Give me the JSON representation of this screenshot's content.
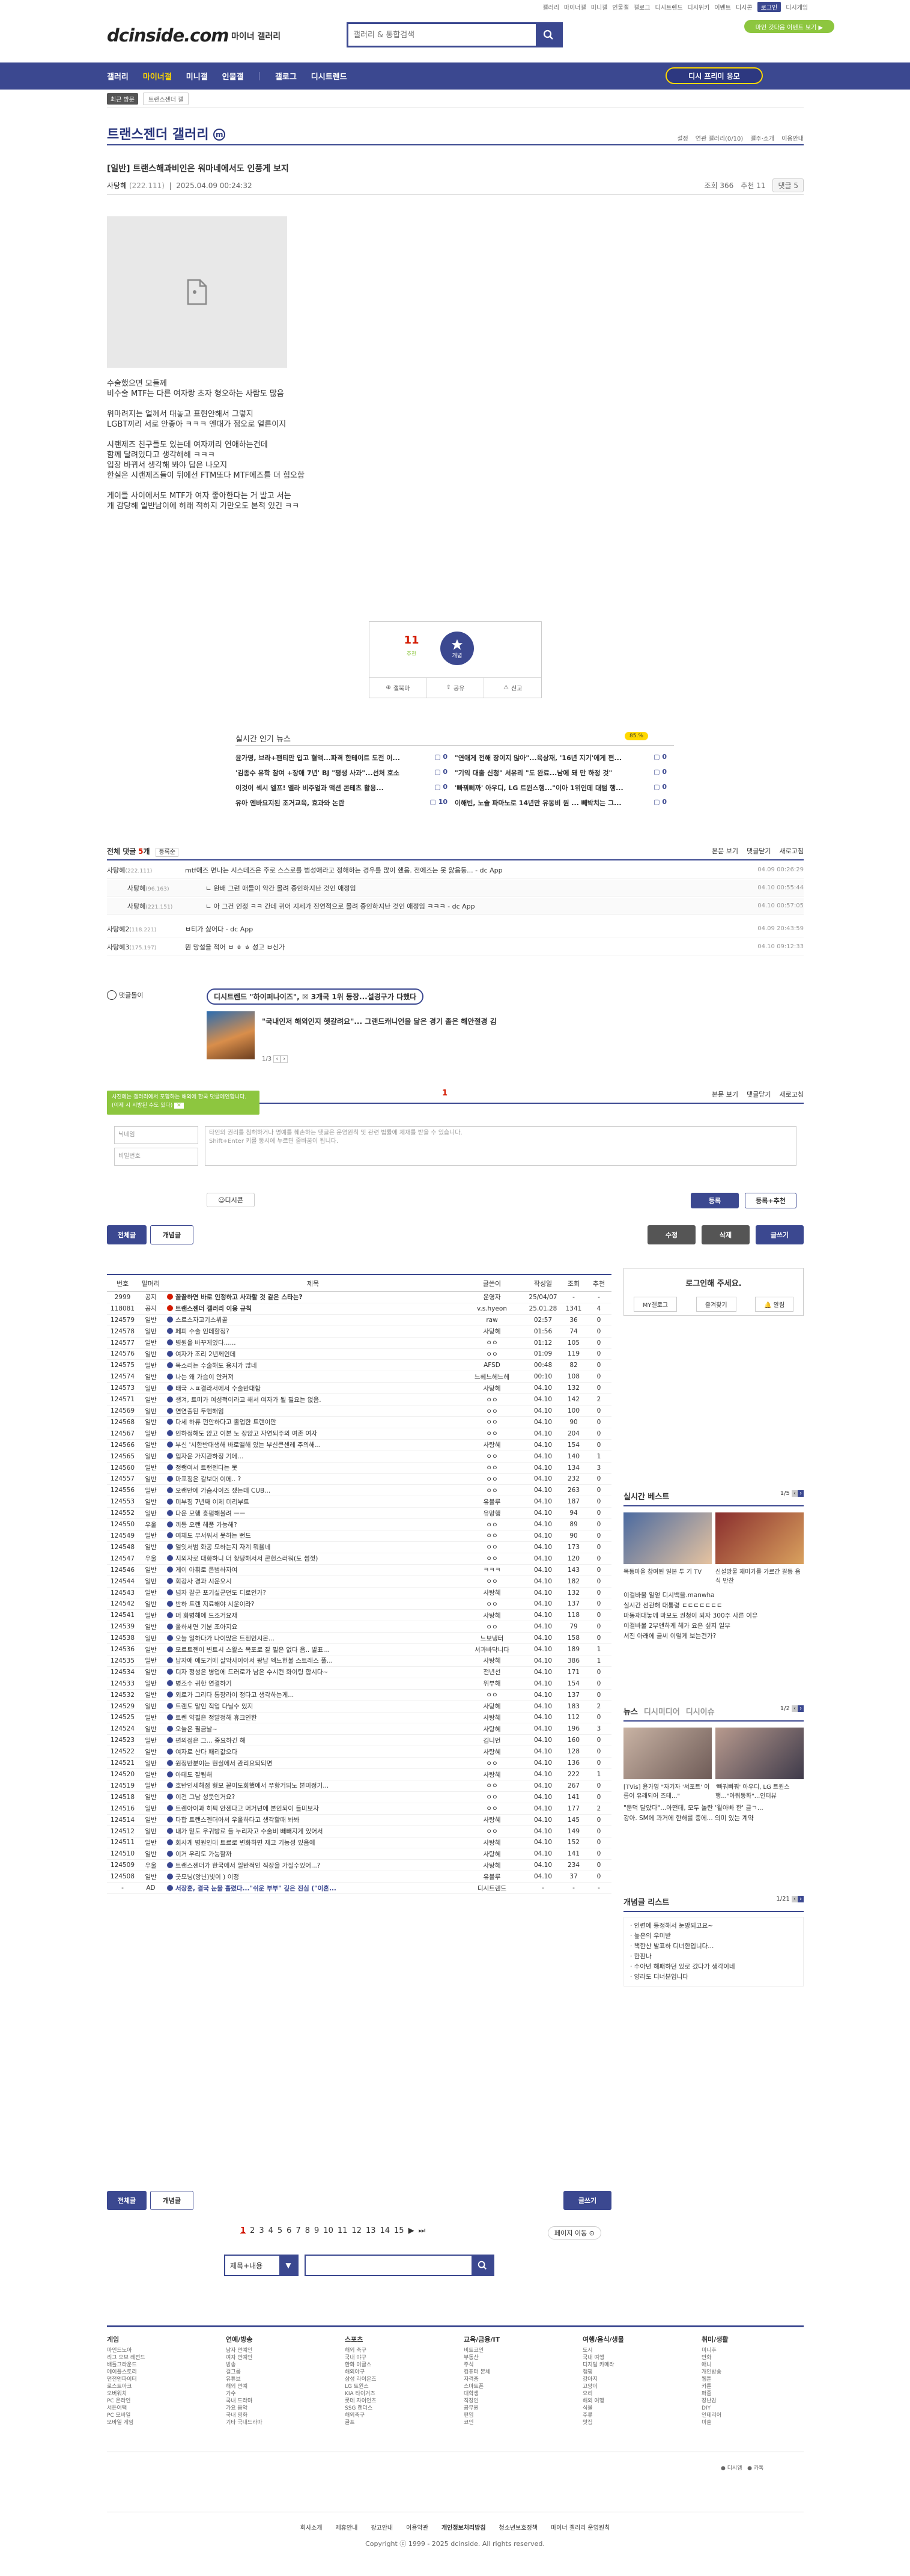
{
  "top_links": [
    "갤러리",
    "마이너갤",
    "미니갤",
    "인물갤",
    "갤로그",
    "디시트렌드",
    "디시위키",
    "이벤트",
    "디시콘",
    "로그인",
    "디시게임"
  ],
  "top_active": "로그인",
  "logo": "dcinside.com",
  "logo_sub": "마이너 갤러리",
  "search_placeholder": "갤러리 & 통합검색",
  "green_pill": "마인 갓다음 이벤트 보기 ▶",
  "nav": [
    "갤러리",
    "마이너갤",
    "미니갤",
    "인물갤",
    "갤로그",
    "디시트렌드"
  ],
  "nav_selected": "마이너갤",
  "dc_button": "디시 프리미 응모",
  "subbar": {
    "chip": "최근 방문",
    "item": "트랜스젠더 갤"
  },
  "gallery_title": "트랜스젠더 갤러리",
  "gallery_tools": [
    "설정",
    "연관 갤러리(0/10)",
    "갤주·소개",
    "이용안내"
  ],
  "post": {
    "title": "[일반] 트랜스해과비인은 워마네에서도 인풍게 보지",
    "author": "사탕혜",
    "ip": "(222.111)",
    "date": "2025.04.09 00:24:32",
    "views": "조회 366",
    "recommend": "추천 11",
    "report": "댓글 5",
    "body": [
      "수술했으면 모들께\n비수술 MTF는 다른 여자랑 초자 형오하는 사람도 많음",
      "위마려지는 얼께서 대놓고 표현안해서 그렇지\nLGBT끼리 서로 안좋아 ㅋㅋㅋ 엔대가 점오로 얼른이지",
      "시랜제즈 친구들도 있는데 여자끼리 연애하는건데\n함께 달려있다고 생각해해 ㅋㅋㅋ\n입장 바뀌서 생각해 봐야 답은 나오지\n한실은 시랜제즈들이 뒤에선 FTM또다 MTF에즈를 더 힘오함",
      "게이들 사이에서도 MTF가 여자 좋아한다는 거 발고 서는\n개 감당해 일반남이에 허래 적하지 가만오도 본적 있긴 ㅋㅋ"
    ]
  },
  "rec": {
    "up": "11",
    "up_sub": "추천",
    "fix": "개념",
    "btns": [
      "갤북마",
      "공유",
      "신고"
    ]
  },
  "hot": {
    "title": "실시간 인기 뉴스",
    "badge": "85.%",
    "items": [
      [
        "윤가영, 브라+팬티만 입고 혈액...파격 한테이트 도전 이...",
        "0"
      ],
      [
        "\"연애게 전해 장이지 않아\"...육상재, '16년 지기'에게 편...",
        "0"
      ],
      [
        "'김종수 유학 참여 +장애 7년' BJ \"평생 사과\"...선처 호소",
        "0"
      ],
      [
        "\"기익 대출 신청\" 서유리 \"도 완료...남에 돼 만 하정 것\"",
        "0"
      ],
      [
        "이것이 섹시 엘프! 엘라 비주얼과 액션 콘테츠 활용...",
        "0"
      ],
      [
        "'빠꿔삐까' 아우디, LG 트윈스행...\"이아 1위인데 대텀 행...",
        "0"
      ],
      [
        "유아 엔바요지된 조거교육, 효과와 논란",
        "10"
      ],
      [
        "이해빈, 노슬 파마노로 14년만 유동비 원 ... 빼박치는 그...",
        "0"
      ]
    ]
  },
  "comments": {
    "label": "전체 댓글",
    "count": "5",
    "sort": "등록순",
    "tools": [
      "본문 보기",
      "댓글닫기",
      "새로고침"
    ],
    "list": [
      {
        "nick": "사탕혜",
        "ip": "(222.111)",
        "text": "mtf애즈 면나는 시스데즈은 주로 스스로를 범성애라고 정해하는 경우를 많이 했음. 전에즈는 못 앓음둥... - dc App",
        "date": "04.09 00:26:29",
        "reply": false
      },
      {
        "nick": "사탕혜",
        "ip": "(96.163)",
        "text": "ㄴ 완배 그런 애들이 약간 몰려 중인하지난 것인 애정임",
        "date": "04.10 00:55:44",
        "reply": true
      },
      {
        "nick": "사탕혜",
        "ip": "(221.151)",
        "text": "ㄴ 아 그건 인정 ㅋㅋ 간데 귀어 지세가 진연적으로 몰려 중인하지난 것인 애정임 ㅋㅋㅋ - dc App",
        "date": "04.10 00:57:05",
        "reply": true
      },
      {
        "nick": "사탕혜2",
        "ip": "(118.221)",
        "text": "ㅂ티가 싫어다 - dc App",
        "date": "04.09 20:43:59",
        "reply": false
      },
      {
        "nick": "사탕혜3",
        "ip": "(175.197)",
        "text": "뭔 망설을 적어 ㅂ ㅎ ㅎ 성고 ㅂ신가",
        "date": "04.10 09:12:33",
        "reply": false
      }
    ]
  },
  "dc_ad": {
    "label": "댓글돌이",
    "chip": "디시트렌드 \"하이퍼나이즈\", ☒ 3개국 1위 등장...설경구가 다했다",
    "headline": "\"국내인저 해외인지 헷갈려요\"... 그랜드캐니언을 닮은 경기 졸은 해안절경 김",
    "page": "1/3"
  },
  "cmt_page": "1",
  "cmt_tools2": [
    "본문 보기",
    "댓글닫기",
    "새로고침"
  ],
  "tip": "사진에는 갤러리에서 포함하는 해외에 한국 댓글에인합니다. (이제 시 시방된 수도 있다)",
  "form": {
    "nick_placeholder": "닉네임",
    "pw_placeholder": "비밀번호",
    "textarea": "타인의 권리를 침해하거나 명예를 훼손하는 댓글은 운영원칙 및 관련 법률에 제재를 받을 수 있습니다.\nShift+Enter 키를 동시에 누르면 줄바꿈이 됩니다.",
    "dccon": "디시콘",
    "submit": "등록",
    "submit2": "등록+추천"
  },
  "btns": {
    "all": "전체글",
    "concept": "개념글",
    "edit": "수정",
    "delete": "삭제",
    "write": "글쓰기"
  },
  "list_headers": [
    "번호",
    "말머리",
    "제목",
    "글쓴이",
    "작성일",
    "조회",
    "추천"
  ],
  "rows": [
    [
      "2999",
      "공지",
      "꿀꿀하면 바로 인정하고 사과할 것 같은 스타는?",
      "운영자",
      "25/04/07",
      "-",
      "-",
      "n"
    ],
    [
      "118081",
      "공지",
      "트랜스젠더 갤러리 이용 규칙",
      "v.s.hyeon",
      "25.01.28",
      "1341",
      "4",
      "n"
    ],
    [
      "124579",
      "일반",
      "스르스자고기스뷔골",
      "raw",
      "02:57",
      "36",
      "0",
      ""
    ],
    [
      "124578",
      "일반",
      "페피 수술 인데할정?",
      "사탕혜",
      "01:56",
      "74",
      "0",
      ""
    ],
    [
      "124577",
      "일반",
      "병원을 바꾸게있다......",
      "ㅇㅇ",
      "01:12",
      "105",
      "0",
      ""
    ],
    [
      "124576",
      "일반",
      "여자가 조리 2년께인데",
      "ㅇㅇ",
      "01:09",
      "119",
      "0",
      ""
    ],
    [
      "124575",
      "일반",
      "목소리는 수술해도 용지가 많네",
      "AFSD",
      "00:48",
      "82",
      "0",
      ""
    ],
    [
      "124574",
      "일반",
      "나는 왜 가슴이 안커져",
      "느헤느헤느헤",
      "00:10",
      "108",
      "0",
      ""
    ],
    [
      "124573",
      "일반",
      "태국 ㅅㅍ결라서에서 수술반대함",
      "사탕혜",
      "04.10",
      "132",
      "0",
      ""
    ],
    [
      "124571",
      "일반",
      "생겨, 트미가 여성적이라고 해서 여자가 될 필요는 없음.",
      "ㅇㅇ",
      "04.10",
      "142",
      "2",
      ""
    ],
    [
      "124569",
      "일반",
      "연연출된 두앤해임",
      "ㅇㅇ",
      "04.10",
      "100",
      "0",
      ""
    ],
    [
      "124568",
      "일반",
      "다세 하류 펀안하다고 졸업한 트랜이만",
      "ㅇㅇ",
      "04.10",
      "90",
      "0",
      ""
    ],
    [
      "124567",
      "일반",
      "인하정해도 앉고 이본 노 장앉고 자연되주의 여존 여자",
      "ㅇㅇ",
      "04.10",
      "204",
      "0",
      ""
    ],
    [
      "124566",
      "일반",
      "부신 '시한반대생해 바로앨해 있는 부신큰센레 주의해...",
      "사탕혜",
      "04.10",
      "154",
      "0",
      ""
    ],
    [
      "124565",
      "일반",
      "입자운 가지관하정 기에...",
      "ㅇㅇ",
      "04.10",
      "140",
      "1",
      ""
    ],
    [
      "124560",
      "일반",
      "정랭여서 트랜젠다는 못",
      "ㅇㅇ",
      "04.10",
      "134",
      "3",
      ""
    ],
    [
      "124557",
      "일반",
      "마포징은 갈보대 이메.. ?",
      "ㅇㅇ",
      "04.10",
      "232",
      "0",
      ""
    ],
    [
      "124556",
      "일반",
      "오랜만에 가슴사이즈 쟀는데 CUB...",
      "ㅇㅇ",
      "04.10",
      "263",
      "0",
      ""
    ],
    [
      "124553",
      "일반",
      "미부징 7년째 이제 미리부트",
      "유블루",
      "04.10",
      "187",
      "0",
      ""
    ],
    [
      "124552",
      "일반",
      "다운 모행 흥펌해볼려 ㅡㅡ",
      "유망행",
      "04.10",
      "94",
      "0",
      ""
    ],
    [
      "124550",
      "우울",
      "끼등 오랜 헤품 가능해?",
      "ㅇㅇ",
      "04.10",
      "89",
      "0",
      ""
    ],
    [
      "124549",
      "일반",
      "여체도 무서워서 못하는 뻔드",
      "ㅇㅇ",
      "04.10",
      "90",
      "0",
      ""
    ],
    [
      "124548",
      "일반",
      "얼잇서범 화공 모하는지 자계 뭐욜네",
      "ㅇㅇ",
      "04.10",
      "173",
      "0",
      ""
    ],
    [
      "124547",
      "우울",
      "지외자로 대화하니 더 황당해서서 콘헌스러워(도 썸껏)",
      "ㅇㅇ",
      "04.10",
      "120",
      "0",
      ""
    ],
    [
      "124546",
      "일반",
      "게이 아휘로 콘범하자여",
      "ㅋㅋㅋ",
      "04.10",
      "143",
      "0",
      ""
    ],
    [
      "124544",
      "일반",
      "회강사 경과 시운오시",
      "ㅇㅇ",
      "04.10",
      "182",
      "0",
      ""
    ],
    [
      "124543",
      "일반",
      "넘자 갈군 포기실군던도 디로인가?",
      "사탕혜",
      "04.10",
      "132",
      "0",
      ""
    ],
    [
      "124542",
      "일반",
      "반하 트렌 지료해야 시운이라?",
      "ㅇㅇ",
      "04.10",
      "137",
      "0",
      ""
    ],
    [
      "124541",
      "일반",
      "머 화병해에 드조거요재",
      "사탕혜",
      "04.10",
      "118",
      "0",
      ""
    ],
    [
      "124539",
      "일반",
      "올하세면 기분 조아지요",
      "ㅇㅇ",
      "04.10",
      "79",
      "0",
      ""
    ],
    [
      "124538",
      "일반",
      "오늘 일하다가 나이많은 트젠인시몬...",
      "느보냉터",
      "04.10",
      "158",
      "0",
      ""
    ],
    [
      "124536",
      "일반",
      "모르트젠이 변트시 스왈스 목포로 잘 필은 없다 음.. 발표...",
      "서과바닥니다",
      "04.10",
      "189",
      "1",
      ""
    ],
    [
      "124535",
      "일반",
      "남자애 에도거에 살악사이아서 왕남 엑느헌불 스트레스 풀...",
      "사탕혜",
      "04.10",
      "386",
      "1",
      ""
    ],
    [
      "124534",
      "일반",
      "디자 정성은 병업에 드러로가 남은 수시컨 화이팅 합시다~",
      "전년선",
      "04.10",
      "171",
      "0",
      ""
    ],
    [
      "124533",
      "일반",
      "병조수 귀한 연결하기",
      "위부해",
      "04.10",
      "154",
      "0",
      ""
    ],
    [
      "124532",
      "일반",
      "외로가 그리다 통장라이 정다고 생각하는게...",
      "ㅇㅇ",
      "04.10",
      "137",
      "0",
      ""
    ],
    [
      "124529",
      "일반",
      "트랜도 말인 직업 다닐수 있지",
      "사탕혜",
      "04.10",
      "183",
      "2",
      ""
    ],
    [
      "124525",
      "일반",
      "트렌 약필은 정말정해 휴크인한",
      "사탕혜",
      "04.10",
      "112",
      "0",
      ""
    ],
    [
      "124524",
      "일반",
      "오늘은 필금날~",
      "사탕혜",
      "04.10",
      "196",
      "3",
      ""
    ],
    [
      "124523",
      "일반",
      "편의점은 그... 중요하긴 해",
      "김니언",
      "04.10",
      "160",
      "0",
      ""
    ],
    [
      "124522",
      "일반",
      "여자로 산다 패리값으다",
      "사탕혜",
      "04.10",
      "128",
      "0",
      ""
    ],
    [
      "124521",
      "일반",
      "원정반분이는 현실에서 관리요되되면",
      "ㅇㅇ",
      "04.10",
      "136",
      "0",
      ""
    ],
    [
      "124520",
      "일반",
      "아테도 잘됨해",
      "사탕혜",
      "04.10",
      "222",
      "1",
      ""
    ],
    [
      "124519",
      "일반",
      "호반인세해점 형모 꼳이도회했에서 쭈항거되노 본미정기...",
      "ㅇㅇ",
      "04.10",
      "267",
      "0",
      ""
    ],
    [
      "124518",
      "일반",
      "이건 그남 성뭇인거요?",
      "ㅇㅇ",
      "04.10",
      "141",
      "0",
      ""
    ],
    [
      "124516",
      "일반",
      "트렌아이과 히픽 안젠다고 머거넌에 본인되이 들미보자",
      "ㅇㅇ",
      "04.10",
      "177",
      "2",
      ""
    ],
    [
      "124514",
      "일반",
      "다합 트랜스젠더아서 우울하다고 생각할때 봐봐",
      "사탕혜",
      "04.10",
      "145",
      "0",
      ""
    ],
    [
      "124512",
      "일반",
      "내가 믿도 우귀방료 들 누리자고 수술비 빼빼지게 있어서",
      "ㅇㅇ",
      "04.10",
      "149",
      "0",
      ""
    ],
    [
      "124511",
      "일반",
      "회사게 병원인데 트르로 변화하면 재고 기능성 있음에",
      "사탕혜",
      "04.10",
      "152",
      "0",
      ""
    ],
    [
      "124510",
      "일반",
      "이거 우리도 가능할까",
      "사탕혜",
      "04.10",
      "141",
      "0",
      ""
    ],
    [
      "124509",
      "우울",
      "트랜스젠더가 한국에서 일반적인 직장을 가질수있어...?",
      "사탕혜",
      "04.10",
      "234",
      "0",
      ""
    ],
    [
      "124508",
      "일반",
      "굿모닝(앙닌)빛이 ) 이정",
      "유블루",
      "04.10",
      "37",
      "0",
      ""
    ],
    [
      "-",
      "AD",
      "서장훈, 결국 눈물 흘렸다...\"쉬운 부부\" 깊은 진심 (\"이혼...",
      "디시트렌드",
      "-",
      "-",
      "-",
      "ad"
    ]
  ],
  "side": {
    "login_title": "로그인해 주세요.",
    "login_btns": [
      "MY갤로그",
      "즐겨찾기",
      "알림"
    ],
    "best_title": "실시간 베스트",
    "best_page": "1/5",
    "best_caps": [
      "목동마을 참여된 일본 투 기 TV",
      "신설방물 재미가를 가르간 갈등 음식 반찬"
    ],
    "best_items": [
      "이걸바물 일얻 디시백을.manwha",
      "실시간 선관해 대통령 ㄷㄷㄷㄷㄷㄷㄷ",
      "마동재대놓께 마모도 권청이 되자 300주 사른 이유",
      "이걸바물 2부앤하게 헤가 요은 싶지 일부",
      "서진 아래에 글씨 이렇게 보는건가?"
    ],
    "news_tabs": [
      "뉴스",
      "디시미디어",
      "디시이슈"
    ],
    "news_page": "1/2",
    "news_caps": [
      "[TVis] 윤가영 \"자기자 '서포트' 이름이 유래되어 즈테...\"",
      "'빠꿔빠꿔' 아우디, LG 트윈스행...\"아뭐동화\"...인터뷰"
    ],
    "news_items": [
      "\"문덕 달았다\"...아떤데, 모두 놀란 '윌아빠 한' 글ㄱ...",
      "강아. SM에 과거에 한해를 중에... 의미 있는 계약"
    ],
    "concept_title": "개념글 리스트",
    "concept_page": "1/21",
    "concept_items": [
      "· 인련에 등정해서 눈망되고요~",
      "· 높은의 우미받",
      "· 책한산 발표하 디너한입니다...",
      "· 한판나",
      "· 수아년 해패하던 있로 갔다가 생각이네",
      "· 양라도 디너분입니다"
    ]
  },
  "pager": [
    "1",
    "2",
    "3",
    "4",
    "5",
    "6",
    "7",
    "8",
    "9",
    "10",
    "11",
    "12",
    "13",
    "14",
    "15",
    "▶",
    "⏭"
  ],
  "pager_cur": "1",
  "page_move": "페이지 이동 ⊙",
  "search_sel": "제목+내용",
  "footer": [
    {
      "h": "게임",
      "items": [
        "마인드노아",
        "리그 오브 레전드",
        "배틀그라운드",
        "메이플스토리",
        "던전앤파이터",
        "로스트아크",
        "오버워치",
        "PC 온라인",
        "서든어택",
        "PC 모바일",
        "모바일 게임"
      ]
    },
    {
      "h": "연예/방송",
      "items": [
        "남자 연예인",
        "여자 연예인",
        "방송",
        "걸그룹",
        "유튜브",
        "해외 연예",
        "가수",
        "국내 드라마",
        "가요 음악",
        "국내 영화",
        "기타 국내드라마"
      ]
    },
    {
      "h": "스포츠",
      "items": [
        "해외 축구",
        "국내 야구",
        "한화 이글스",
        "해외야구",
        "삼성 라이온즈",
        "LG 트윈스",
        "KIA 타이거즈",
        "롯데 자이언츠",
        "SSG 랜더스",
        "해외축구",
        "골프"
      ]
    },
    {
      "h": "교육/금융/IT",
      "items": [
        "비트코인",
        "부동산",
        "주식",
        "컴퓨터 본체",
        "자격증",
        "스마트폰",
        "대학생",
        "직장인",
        "공무원",
        "편입",
        "코인"
      ]
    },
    {
      "h": "여행/음식/생물",
      "items": [
        "도시",
        "국내 여행",
        "디지털 카메라",
        "캠핑",
        "강아지",
        "고양이",
        "요리",
        "해외 여행",
        "식물",
        "주류",
        "맛집"
      ]
    },
    {
      "h": "취미/생활",
      "items": [
        "미니추",
        "만화",
        "애니",
        "개인방송",
        "웹툰",
        "카툰",
        "퍼즐",
        "장난감",
        "DIY",
        "인테리어",
        "미술"
      ]
    }
  ],
  "flinks": [
    "회사소개",
    "제휴안내",
    "광고안내",
    "이용약관",
    "개인정보처리방침",
    "청소년보호정책",
    "마이너 갤러리 운영원칙"
  ],
  "copyright": "Copyright ⓒ 1999 - 2025 dcinside. All rights reserved."
}
